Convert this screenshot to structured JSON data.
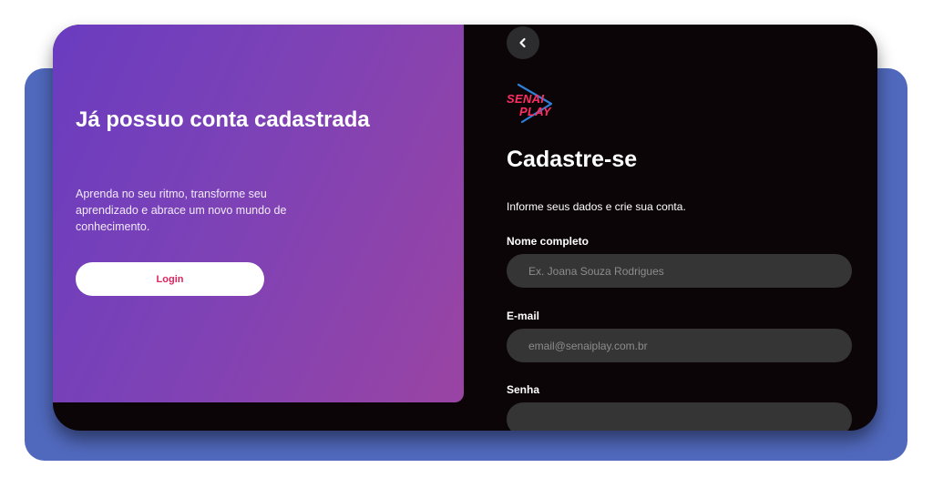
{
  "left_panel": {
    "title": "Já possuo conta cadastrada",
    "description": "Aprenda no seu ritmo, transforme seu aprendizado e abrace um novo mundo de conhecimento.",
    "login_label": "Login"
  },
  "logo": {
    "line1": "SENAI",
    "line2": "PLAY",
    "icon": "play-triangle-icon"
  },
  "form": {
    "back_icon": "chevron-left-icon",
    "title": "Cadastre-se",
    "subtitle": "Informe seus dados e crie sua conta.",
    "fields": [
      {
        "label": "Nome completo",
        "placeholder": "Ex. Joana Souza Rodrigues",
        "value": ""
      },
      {
        "label": "E-mail",
        "placeholder": "email@senaiplay.com.br",
        "value": ""
      },
      {
        "label": "Senha",
        "placeholder": "",
        "value": ""
      }
    ]
  },
  "colors": {
    "backdrop": "#5169bd",
    "card": "#0c0508",
    "gradient_start": "#6a3cc0",
    "gradient_end": "#9a44a3",
    "accent": "#e0245e",
    "input_bg": "#353535"
  }
}
